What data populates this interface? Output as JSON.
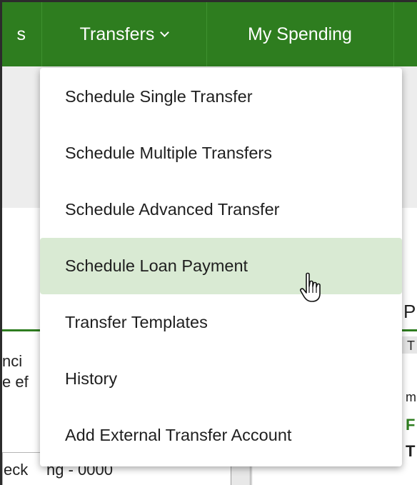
{
  "nav": {
    "cut_label": "s",
    "transfers_label": "Transfers",
    "my_spending_label": "My Spending"
  },
  "menu": {
    "items": [
      {
        "label": "Schedule Single Transfer"
      },
      {
        "label": "Schedule Multiple Transfers"
      },
      {
        "label": "Schedule Advanced Transfer"
      },
      {
        "label": "Schedule Loan Payment"
      },
      {
        "label": "Transfer Templates"
      },
      {
        "label": "History"
      },
      {
        "label": "Add External Transfer Account"
      }
    ],
    "active_index": 3
  },
  "background": {
    "left_text_1": "nci",
    "left_text_2": "e ef",
    "left_select": "eck",
    "left_select_tail": "ng - 0000",
    "right_heading": "P",
    "right_col": "T",
    "right_line_1": "m",
    "right_line_2": "F",
    "right_line_3": "T"
  },
  "colors": {
    "nav_green": "#2e7d1f",
    "menu_highlight": "#d9ead3"
  }
}
